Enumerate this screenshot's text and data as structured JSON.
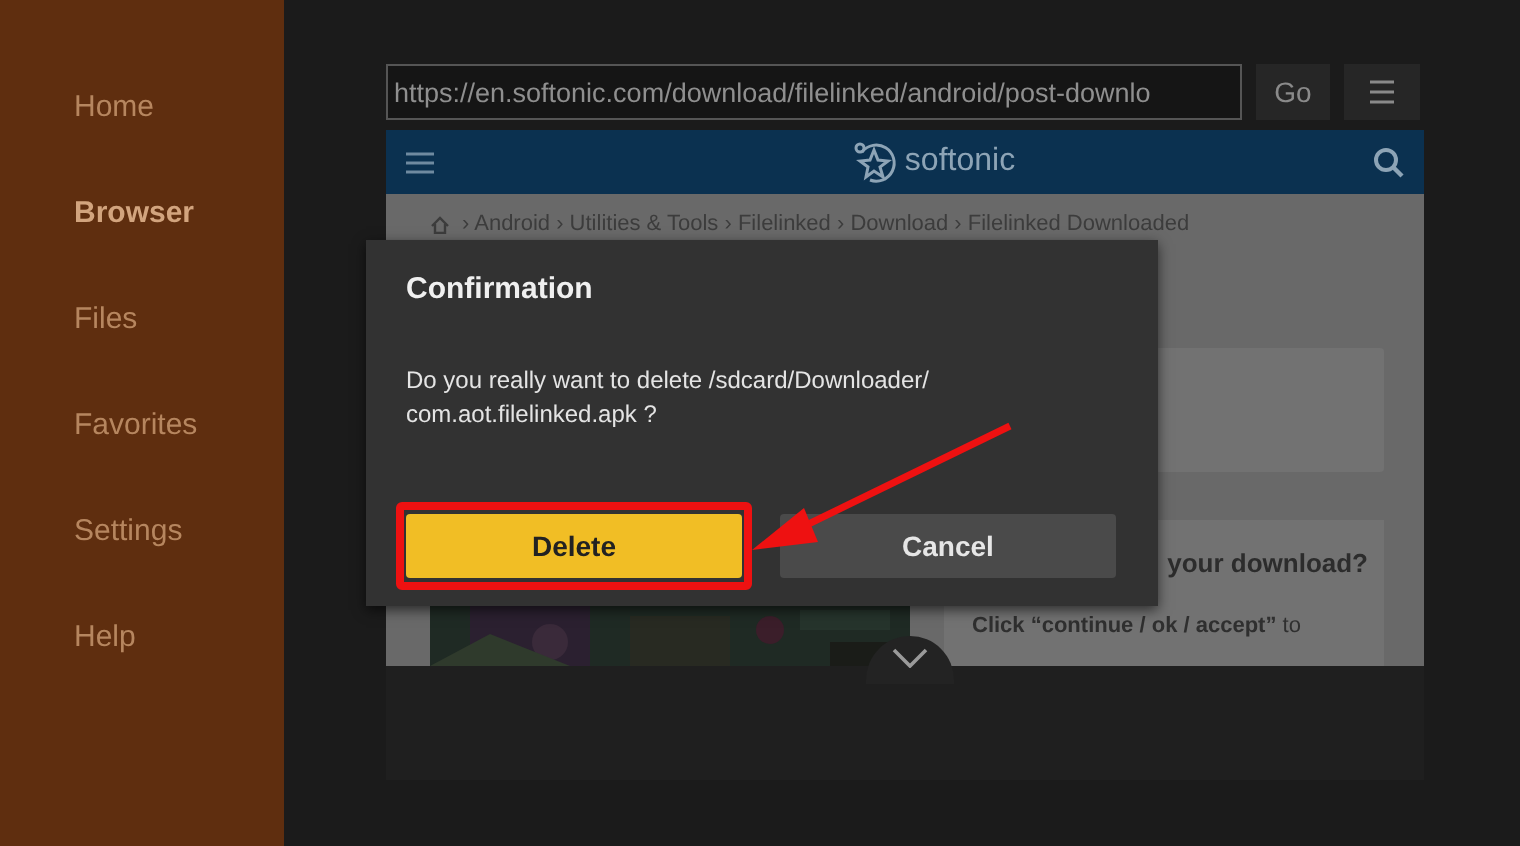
{
  "sidebar": {
    "items": [
      {
        "label": "Home",
        "selected": false
      },
      {
        "label": "Browser",
        "selected": true
      },
      {
        "label": "Files",
        "selected": false
      },
      {
        "label": "Favorites",
        "selected": false
      },
      {
        "label": "Settings",
        "selected": false
      },
      {
        "label": "Help",
        "selected": false
      }
    ]
  },
  "toolbar": {
    "url": "https://en.softonic.com/download/filelinked/android/post-downlo",
    "go_button": "Go"
  },
  "web_page": {
    "site_name": "softonic",
    "breadcrumb": "› Android › Utilities & Tools › Filelinked › Download › Filelinked Downloaded",
    "download_heading": "your download?",
    "instruction": "**Click “continue / ok / accept”** to"
  },
  "dialog": {
    "title": "Confirmation",
    "message": "Do you really want to delete /sdcard/Downloader/ com.aot.filelinked.apk ?",
    "buttons": [
      {
        "label": "Delete",
        "selected": true
      },
      {
        "label": "Cancel",
        "selected": false
      }
    ]
  }
}
